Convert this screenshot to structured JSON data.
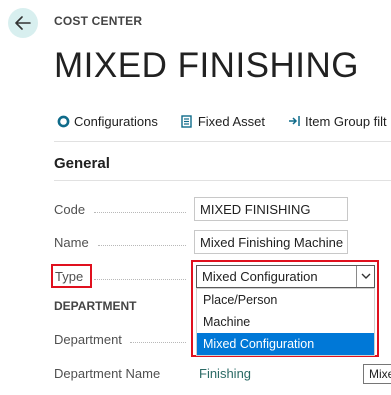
{
  "header": {
    "entity_type": "COST CENTER",
    "title": "MIXED FINISHING",
    "back_icon": "arrow-left-icon"
  },
  "actions": [
    {
      "label": "Configurations",
      "icon": "gear-icon"
    },
    {
      "label": "Fixed Asset",
      "icon": "document-icon"
    },
    {
      "label": "Item Group filt",
      "icon": "filter-arrow-icon"
    }
  ],
  "general": {
    "title": "General",
    "code_label": "Code",
    "code_value": "MIXED FINISHING",
    "name_label": "Name",
    "name_value": "Mixed Finishing Machine",
    "type_label": "Type",
    "type_value": "Mixed Configuration",
    "type_options": [
      "Place/Person",
      "Machine",
      "Mixed Configuration"
    ]
  },
  "department": {
    "title": "DEPARTMENT",
    "department_label": "Department",
    "department_name_label": "Department Name",
    "department_name_value": "Finishing",
    "tooltip": "Mixe"
  },
  "colors": {
    "accent": "#0078d7",
    "highlight_border": "#e0101e",
    "link": "#2b6a65",
    "back_button_bg": "#d8efef"
  }
}
